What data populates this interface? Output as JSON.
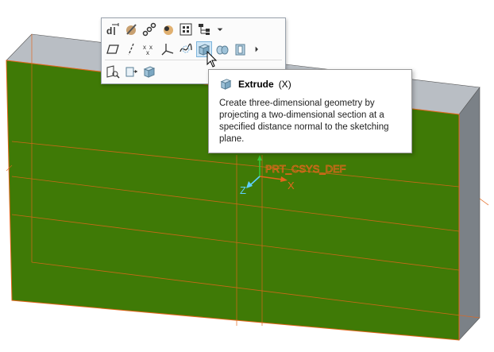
{
  "tooltip": {
    "title": "Extrude",
    "shortcut": "(X)",
    "description": "Create three-dimensional geometry by projecting a two-dimensional section at a specified distance normal to the sketching plane."
  },
  "viewport": {
    "csys_label": "PRT_CSYS_DEF",
    "axis_x": "X",
    "axis_z": "Z"
  },
  "colors": {
    "model_face": "#3f7a06",
    "model_side": "#7b8187",
    "model_top": "#b9bec4",
    "edge": "#e3661c",
    "highlight": "#cfe6f6"
  },
  "toolbar": {
    "row1": [
      "dimension-icon",
      "appearance-icon",
      "chain-icon",
      "render-icon",
      "grid-icon",
      "layer-tree-icon",
      "dropdown-arrow-icon"
    ],
    "row2": [
      "plane-icon",
      "axis-icon",
      "point-icon",
      "coord-system-icon",
      "curve-icon",
      "extrude-icon",
      "revolve-icon",
      "shell-icon",
      "more-arrow-icon"
    ],
    "row3": [
      "view-normal-icon",
      "view-select-icon",
      "view-3d-icon"
    ]
  }
}
